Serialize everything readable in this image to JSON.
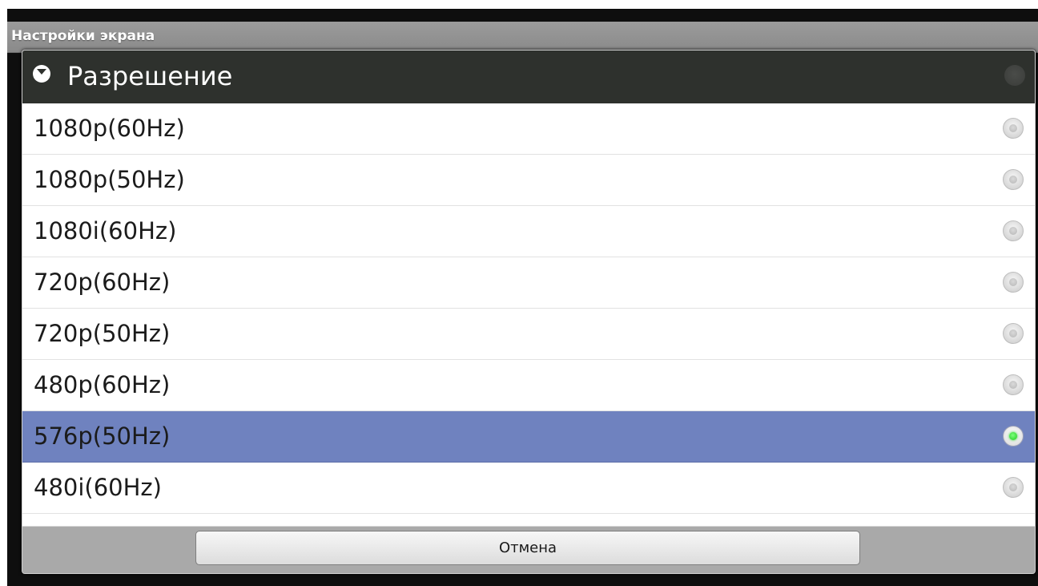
{
  "window": {
    "title": "Настройки экрана"
  },
  "dialog": {
    "title": "Разрешение",
    "header_icon": "chevron-down-circle-icon",
    "options": [
      {
        "label": "1080p(60Hz)",
        "selected": false
      },
      {
        "label": "1080p(50Hz)",
        "selected": false
      },
      {
        "label": "1080i(60Hz)",
        "selected": false
      },
      {
        "label": "720p(60Hz)",
        "selected": false
      },
      {
        "label": "720p(50Hz)",
        "selected": false
      },
      {
        "label": "480p(60Hz)",
        "selected": false
      },
      {
        "label": "576p(50Hz)",
        "selected": true
      },
      {
        "label": "480i(60Hz)",
        "selected": false
      }
    ],
    "cancel_label": "Отмена"
  },
  "colors": {
    "selected_row": "#6f82bf",
    "header_bg": "#2e312d",
    "radio_checked": "#1ecb1e"
  }
}
